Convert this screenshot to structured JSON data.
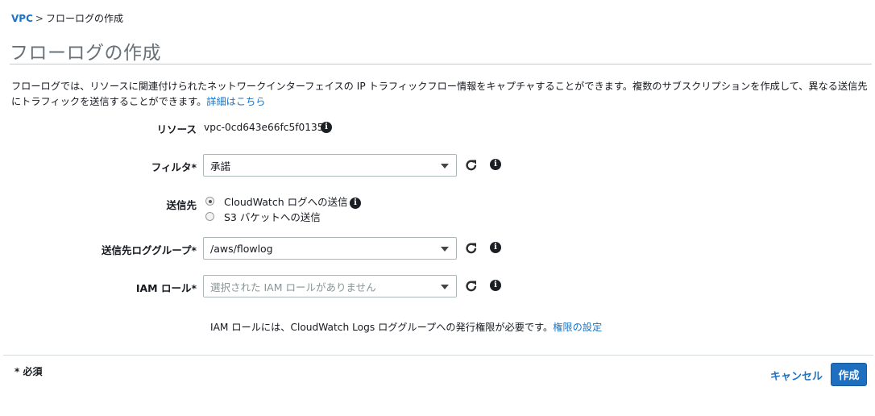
{
  "breadcrumb": {
    "root": "VPC",
    "separator": ">",
    "current": "フローログの作成"
  },
  "page_title": "フローログの作成",
  "description": {
    "text": "フローログでは、リソースに関連付けられたネットワークインターフェイスの IP トラフィックフロー情報をキャプチャすることができます。複数のサブスクリプションを作成して、異なる送信先にトラフィックを送信することができます。",
    "link": "詳細はこちら"
  },
  "form": {
    "resource": {
      "label": "リソース",
      "value": "vpc-0cd643e66fc5f0135"
    },
    "filter": {
      "label": "フィルタ*",
      "value": "承諾"
    },
    "destination": {
      "label": "送信先",
      "options": [
        {
          "label": "CloudWatch ログへの送信",
          "checked": true
        },
        {
          "label": "S3 バケットへの送信",
          "checked": false
        }
      ]
    },
    "log_group": {
      "label": "送信先ロググループ*",
      "value": "/aws/flowlog"
    },
    "iam_role": {
      "label": "IAM ロール*",
      "placeholder": "選択された IAM ロールがありません"
    },
    "iam_note": {
      "text": "IAM ロールには、CloudWatch Logs ロググループへの発行権限が必要です。",
      "link": "権限の設定"
    }
  },
  "footer": {
    "required_note": "* 必須",
    "cancel_label": "キャンセル",
    "create_label": "作成"
  },
  "icons": {
    "info": "info-icon",
    "refresh": "refresh-icon",
    "caret": "caret-down-icon"
  },
  "colors": {
    "link": "#1a73c7",
    "primary_button": "#1f6fc0",
    "title": "#687078"
  }
}
